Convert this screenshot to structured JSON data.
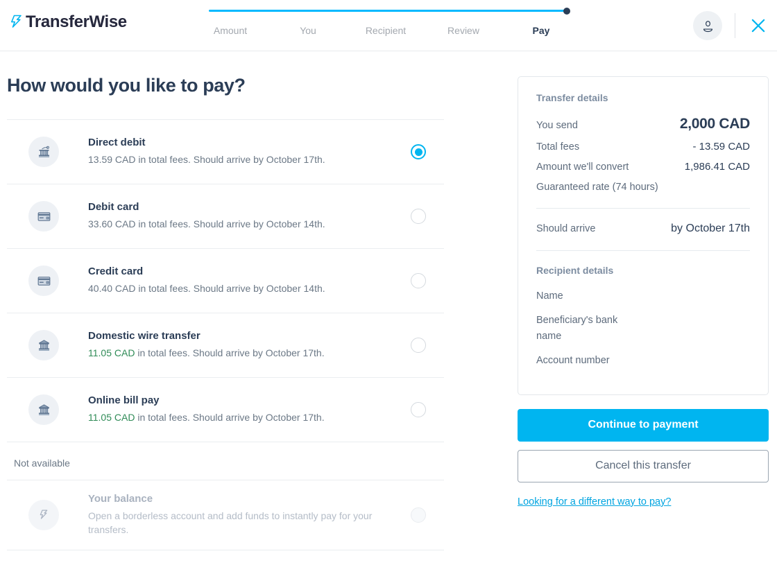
{
  "brand": {
    "name": "TransferWise",
    "accent": "#00b5f0",
    "navy": "#2b3d56",
    "green": "#2f8b57"
  },
  "header": {
    "logo_icon": "transferwise-arrows-logo",
    "avatar_icon": "user-avatar-icon",
    "close_icon": "close-x-icon",
    "steps": [
      {
        "label": "Amount",
        "active": false
      },
      {
        "label": "You",
        "active": false
      },
      {
        "label": "Recipient",
        "active": false
      },
      {
        "label": "Review",
        "active": false
      },
      {
        "label": "Pay",
        "active": true
      }
    ]
  },
  "main": {
    "title": "How would you like to pay?",
    "not_available_label": "Not available",
    "methods": [
      {
        "icon": "bank-direct-debit-icon",
        "title": "Direct debit",
        "fee": "13.59 CAD",
        "fee_cheapest": false,
        "sub_rest": " in total fees. Should arrive by October 17th.",
        "selected": true,
        "disabled": false
      },
      {
        "icon": "debit-card-icon",
        "title": "Debit card",
        "fee": "33.60 CAD",
        "fee_cheapest": false,
        "sub_rest": " in total fees. Should arrive by October 14th.",
        "selected": false,
        "disabled": false
      },
      {
        "icon": "credit-card-icon",
        "title": "Credit card",
        "fee": "40.40 CAD",
        "fee_cheapest": false,
        "sub_rest": " in total fees. Should arrive by October 14th.",
        "selected": false,
        "disabled": false
      },
      {
        "icon": "bank-building-icon",
        "title": "Domestic wire transfer",
        "fee": "11.05 CAD",
        "fee_cheapest": true,
        "sub_rest": " in total fees. Should arrive by October 17th.",
        "selected": false,
        "disabled": false
      },
      {
        "icon": "bank-building-icon",
        "title": "Online bill pay",
        "fee": "11.05 CAD",
        "fee_cheapest": true,
        "sub_rest": " in total fees. Should arrive by October 17th.",
        "selected": false,
        "disabled": false
      }
    ],
    "unavailable_methods": [
      {
        "icon": "transferwise-logo-icon",
        "title": "Your balance",
        "fee": "",
        "fee_cheapest": false,
        "sub_rest": "Open a borderless account and add funds to instantly pay for your transfers.",
        "selected": false,
        "disabled": true
      }
    ]
  },
  "sidebar": {
    "transfer_details_heading": "Transfer details",
    "you_send_label": "You send",
    "you_send_value": "2,000 CAD",
    "total_fees_label": "Total fees",
    "total_fees_value": "- 13.59 CAD",
    "convert_label": "Amount we'll convert",
    "convert_value": "1,986.41 CAD",
    "guaranteed_rate": "Guaranteed rate (74 hours)",
    "should_arrive_label": "Should arrive",
    "should_arrive_value": "by October 17th",
    "recipient_details_heading": "Recipient details",
    "recipient_fields": [
      "Name",
      "Beneficiary's bank name",
      "Account number"
    ]
  },
  "actions": {
    "continue_label": "Continue to payment",
    "cancel_label": "Cancel this transfer",
    "alt_link_label": "Looking for a different way to pay?"
  }
}
